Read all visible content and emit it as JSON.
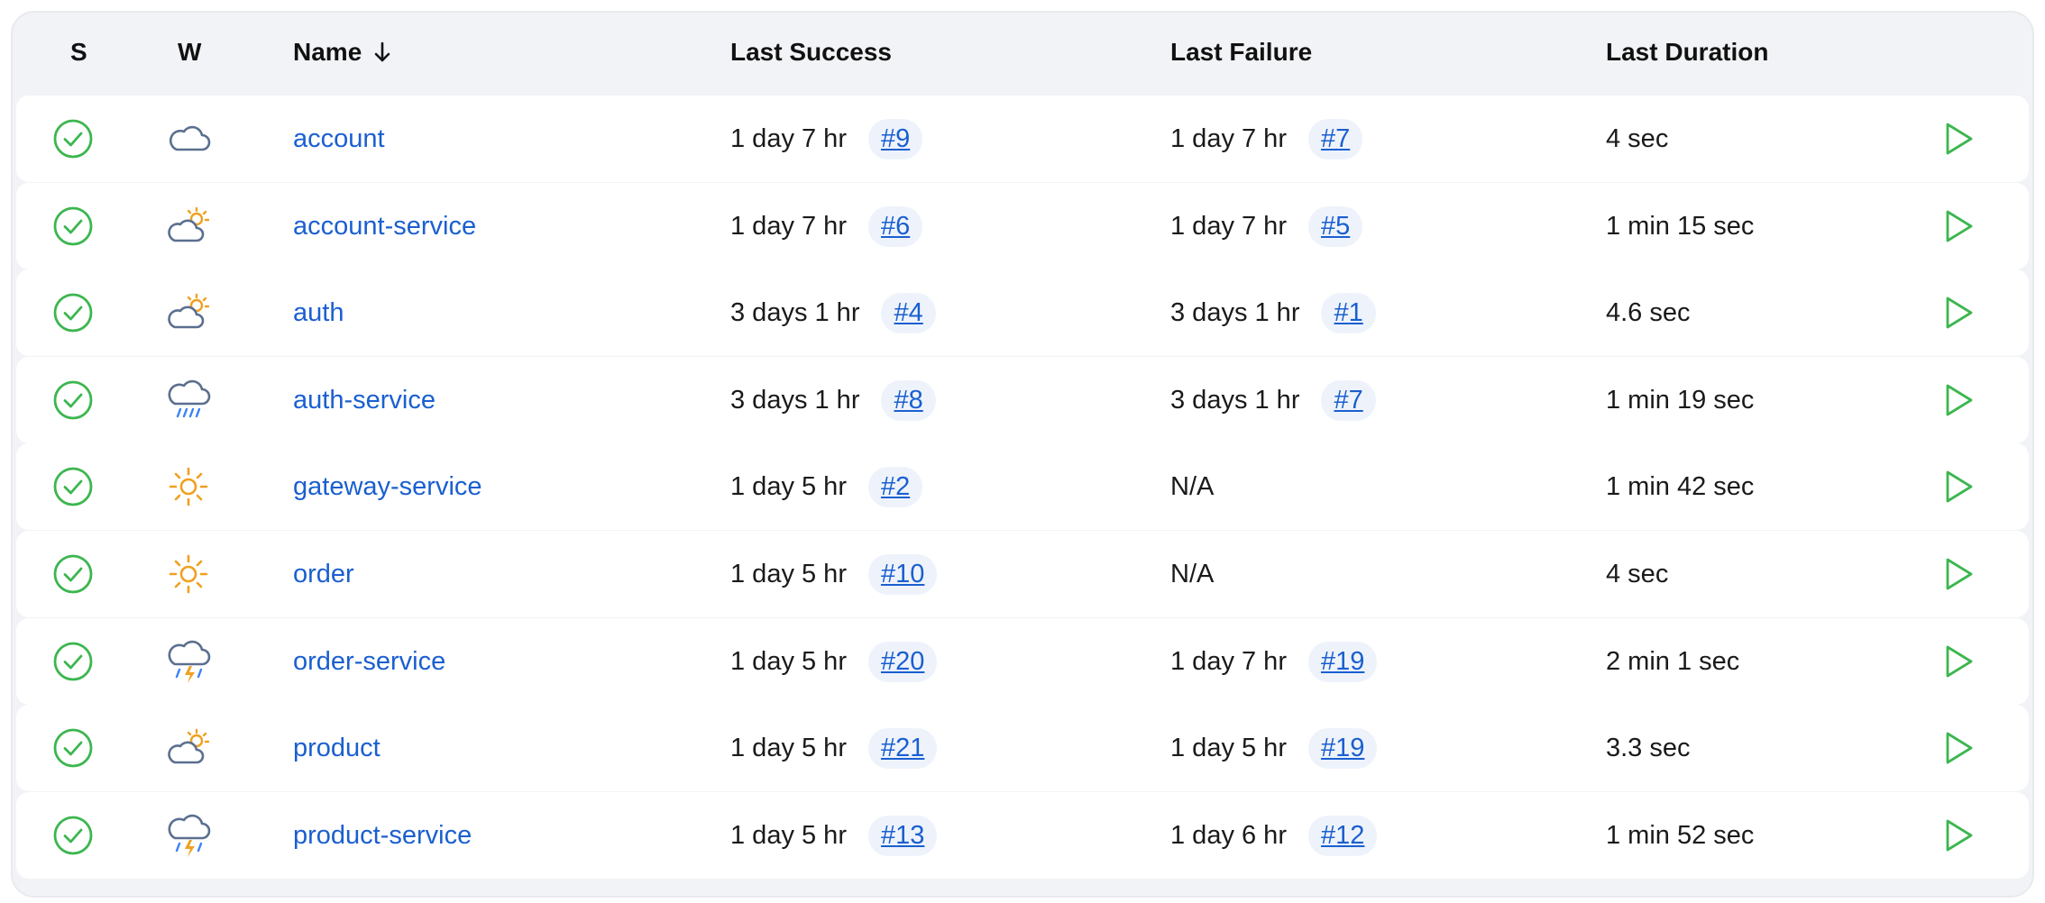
{
  "columns": {
    "status": "S",
    "weather": "W",
    "name": "Name",
    "last_success": "Last Success",
    "last_failure": "Last Failure",
    "last_duration": "Last Duration"
  },
  "colors": {
    "success_green": "#3cb64f",
    "link_blue": "#1a5fd0",
    "cloud_gray": "#5b6f8f",
    "sun_orange": "#f0a020",
    "rain_blue": "#3b82f6"
  },
  "jobs": [
    {
      "name": "account",
      "weather": "cloudy",
      "success_time": "1 day 7 hr",
      "success_build": "#9",
      "failure_time": "1 day 7 hr",
      "failure_build": "#7",
      "duration": "4 sec"
    },
    {
      "name": "account-service",
      "weather": "partly-sunny",
      "success_time": "1 day 7 hr",
      "success_build": "#6",
      "failure_time": "1 day 7 hr",
      "failure_build": "#5",
      "duration": "1 min 15 sec"
    },
    {
      "name": "auth",
      "weather": "partly-sunny",
      "success_time": "3 days 1 hr",
      "success_build": "#4",
      "failure_time": "3 days 1 hr",
      "failure_build": "#1",
      "duration": "4.6 sec"
    },
    {
      "name": "auth-service",
      "weather": "rain",
      "success_time": "3 days 1 hr",
      "success_build": "#8",
      "failure_time": "3 days 1 hr",
      "failure_build": "#7",
      "duration": "1 min 19 sec"
    },
    {
      "name": "gateway-service",
      "weather": "sunny",
      "success_time": "1 day 5 hr",
      "success_build": "#2",
      "failure_time": "N/A",
      "failure_build": "",
      "duration": "1 min 42 sec"
    },
    {
      "name": "order",
      "weather": "sunny",
      "success_time": "1 day 5 hr",
      "success_build": "#10",
      "failure_time": "N/A",
      "failure_build": "",
      "duration": "4 sec"
    },
    {
      "name": "order-service",
      "weather": "storm",
      "success_time": "1 day 5 hr",
      "success_build": "#20",
      "failure_time": "1 day 7 hr",
      "failure_build": "#19",
      "duration": "2 min 1 sec"
    },
    {
      "name": "product",
      "weather": "partly-sunny",
      "success_time": "1 day 5 hr",
      "success_build": "#21",
      "failure_time": "1 day 5 hr",
      "failure_build": "#19",
      "duration": "3.3 sec"
    },
    {
      "name": "product-service",
      "weather": "storm",
      "success_time": "1 day 5 hr",
      "success_build": "#13",
      "failure_time": "1 day 6 hr",
      "failure_build": "#12",
      "duration": "1 min 52 sec"
    }
  ]
}
